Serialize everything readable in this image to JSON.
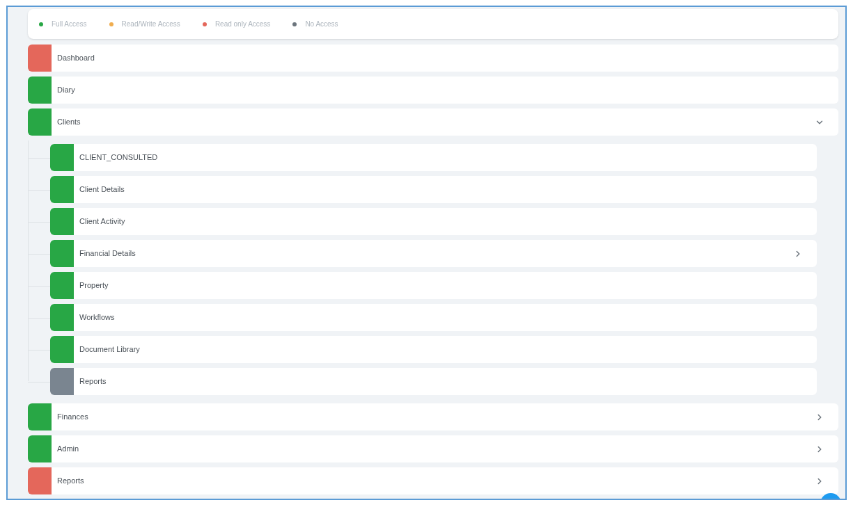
{
  "legend": [
    {
      "label": "Full Access",
      "color": "#28a745"
    },
    {
      "label": "Read/Write Access",
      "color": "#f0ad4e"
    },
    {
      "label": "Read only Access",
      "color": "#e4675b"
    },
    {
      "label": "No Access",
      "color": "#6c757d"
    }
  ],
  "menu": [
    {
      "label": "Dashboard",
      "color": "#e4675b"
    },
    {
      "label": "Diary",
      "color": "#28a745"
    },
    {
      "label": "Clients",
      "color": "#28a745",
      "expanded": true,
      "children": [
        {
          "label": "CLIENT_CONSULTED",
          "color": "#28a745"
        },
        {
          "label": "Client Details",
          "color": "#28a745"
        },
        {
          "label": "Client Activity",
          "color": "#28a745"
        },
        {
          "label": "Financial Details",
          "color": "#28a745",
          "expanded": false
        },
        {
          "label": "Property",
          "color": "#28a745"
        },
        {
          "label": "Workflows",
          "color": "#28a745"
        },
        {
          "label": "Document Library",
          "color": "#28a745"
        },
        {
          "label": "Reports",
          "color": "#7a8590"
        }
      ]
    },
    {
      "label": "Finances",
      "color": "#28a745",
      "expanded": false
    },
    {
      "label": "Admin",
      "color": "#28a745",
      "expanded": false
    },
    {
      "label": "Reports",
      "color": "#e4675b",
      "expanded": false
    }
  ]
}
